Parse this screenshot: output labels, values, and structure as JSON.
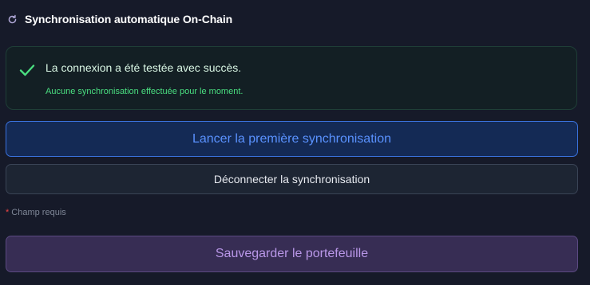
{
  "header": {
    "icon": "refresh-icon",
    "title": "Synchronisation automatique On-Chain"
  },
  "status": {
    "icon": "check-icon",
    "message": "La connexion a été testée avec succès.",
    "detail": "Aucune synchronisation effectuée pour le moment.",
    "color": "#4ade80"
  },
  "actions": {
    "start_sync_label": "Lancer la première synchronisation",
    "disconnect_label": "Déconnecter la synchronisation",
    "save_label": "Sauvegarder le portefeuille"
  },
  "form": {
    "required_marker": "*",
    "required_text": "Champ requis"
  },
  "colors": {
    "background": "#161a29",
    "primary_accent": "#3a72dd",
    "save_accent": "#b997e8",
    "required_star": "#ef4444"
  }
}
